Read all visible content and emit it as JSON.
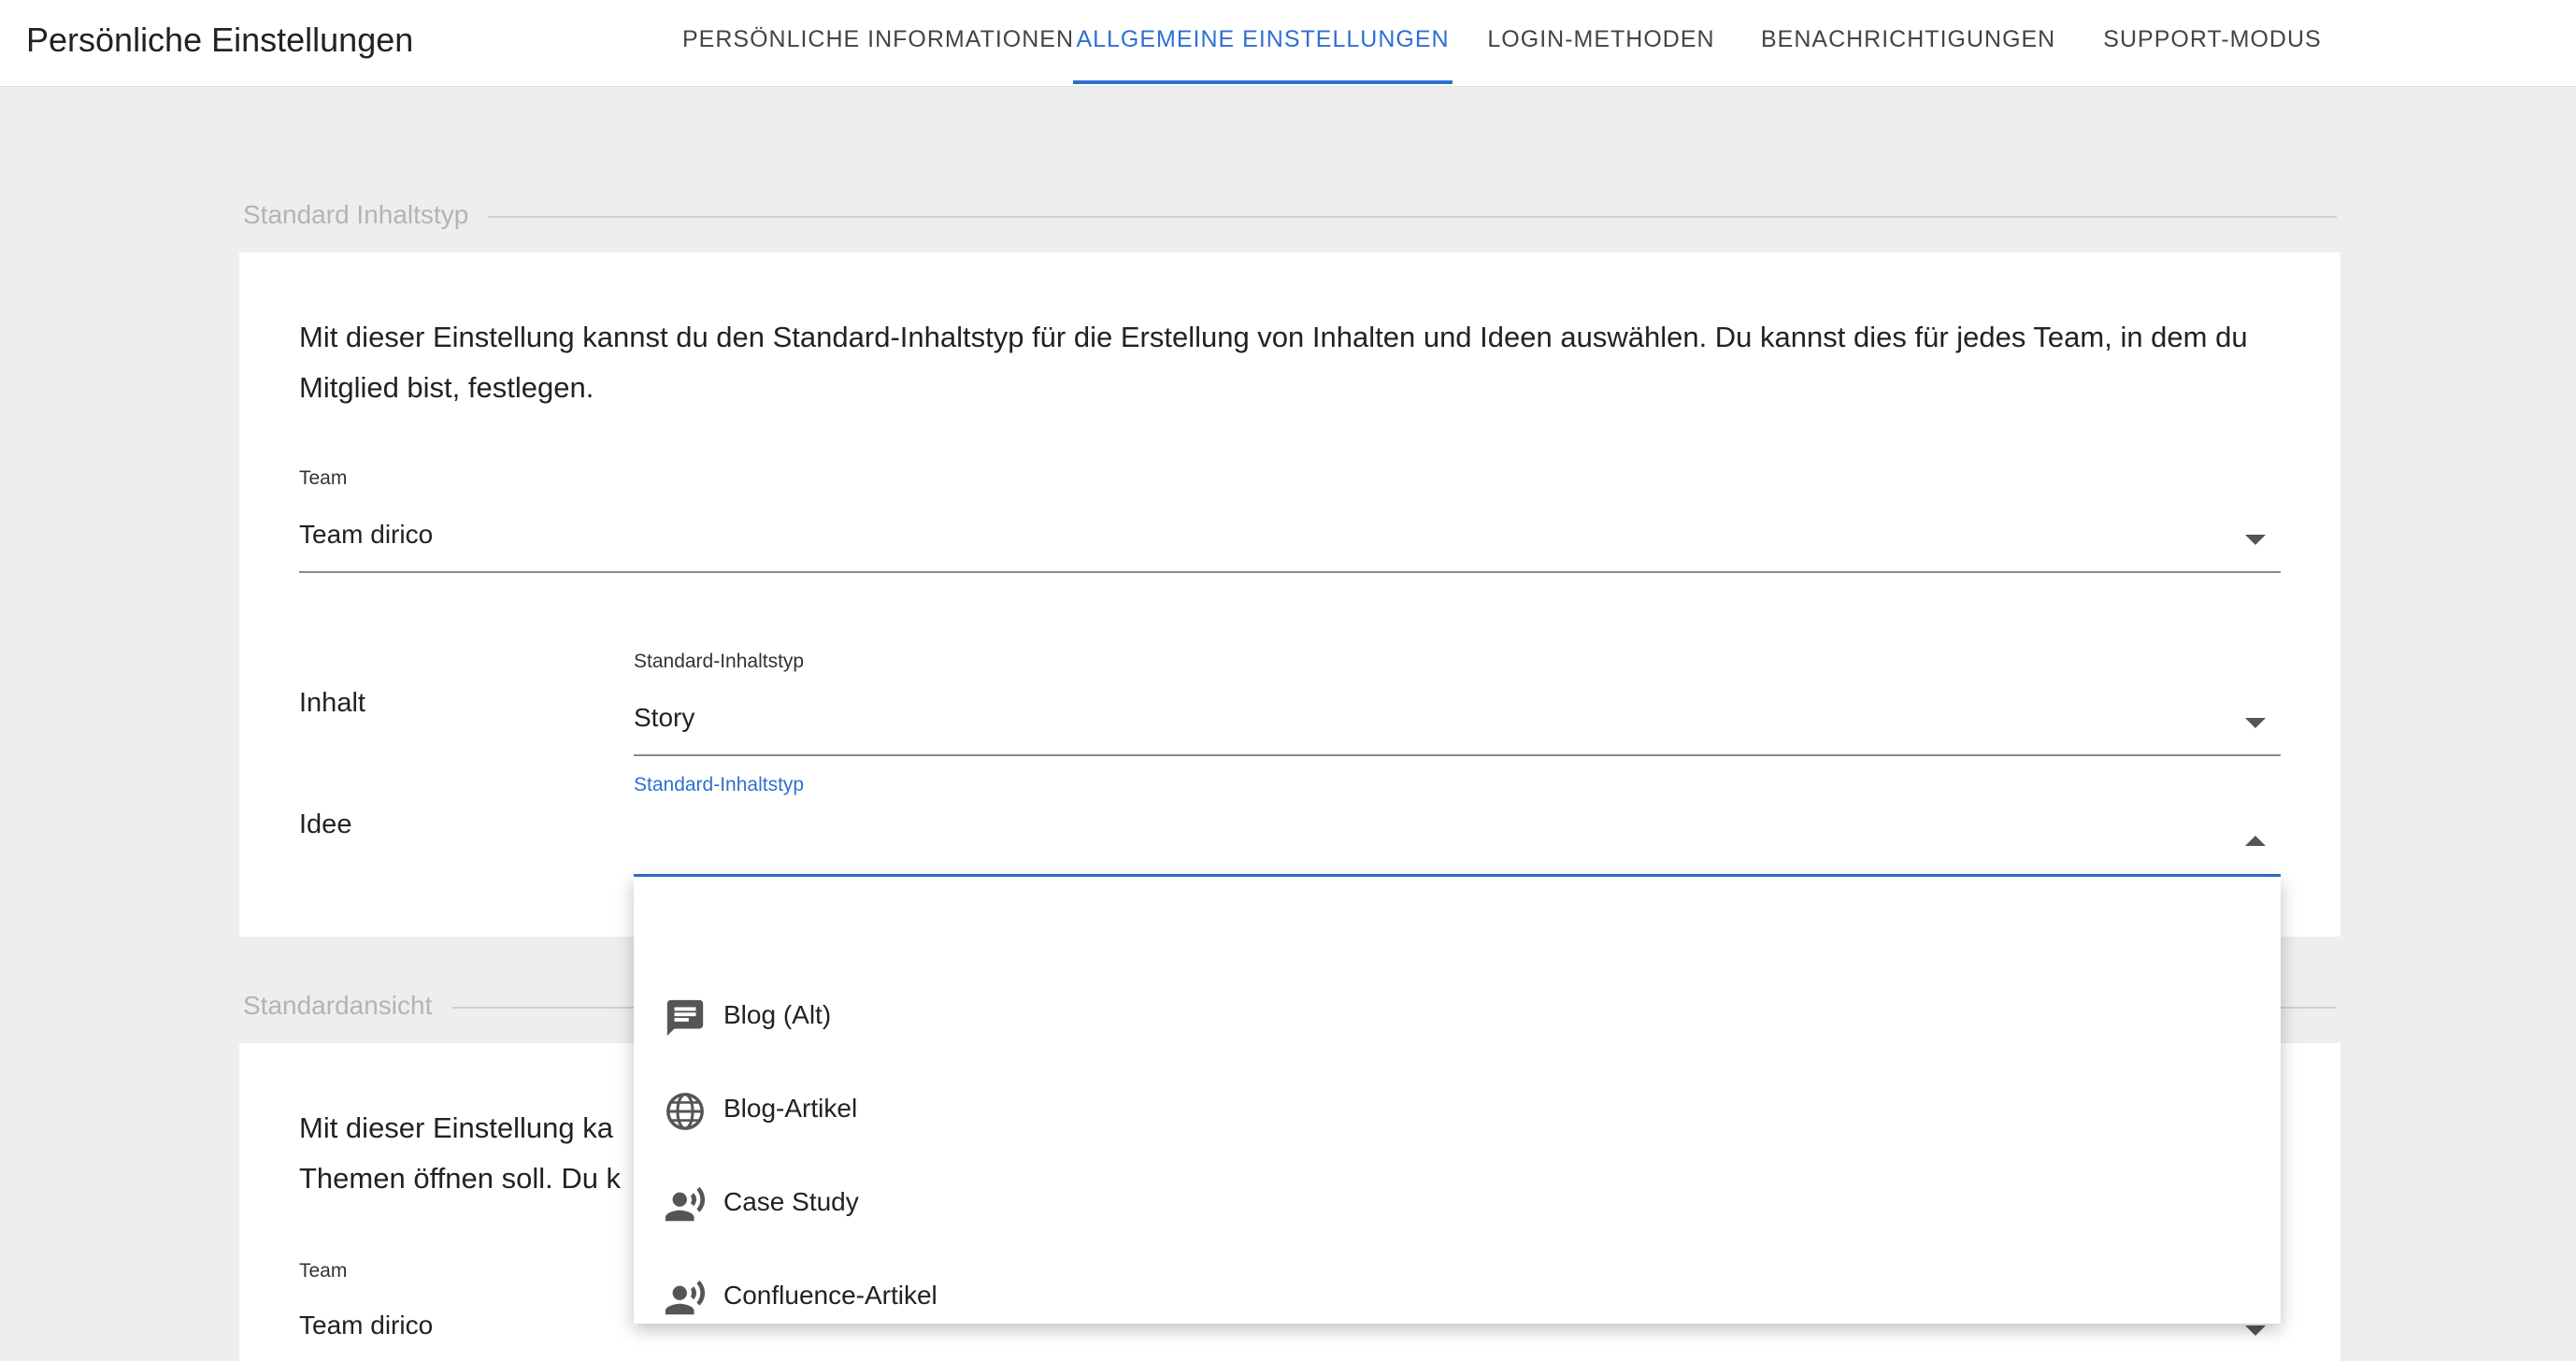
{
  "header": {
    "title": "Persönliche Einstellungen",
    "tabs": [
      {
        "label": "PERSÖNLICHE INFORMATIONEN",
        "active": false
      },
      {
        "label": "ALLGEMEINE EINSTELLUNGEN",
        "active": true
      },
      {
        "label": "LOGIN-METHODEN",
        "active": false
      },
      {
        "label": "BENACHRICHTIGUNGEN",
        "active": false
      },
      {
        "label": "SUPPORT-MODUS",
        "active": false
      }
    ]
  },
  "colors": {
    "accent": "#2f6fd1",
    "background": "#eeeeee",
    "card": "#ffffff"
  },
  "section1": {
    "label": "Standard Inhaltstyp",
    "description": "Mit dieser Einstellung kannst du den Standard-Inhaltstyp für die Erstellung von Inhalten und Ideen auswählen. Du kannst dies für jedes Team, in dem du Mitglied bist, festlegen.",
    "team_label": "Team",
    "team_value": "Team dirico",
    "inhalt_label": "Inhalt",
    "inhalt_field_label": "Standard-Inhaltstyp",
    "inhalt_value": "Story",
    "idee_label": "Idee",
    "idee_field_label": "Standard-Inhaltstyp",
    "idee_value": ""
  },
  "section2": {
    "label": "Standardansicht",
    "desc_line1": "Mit dieser Einstellung ka",
    "desc_line2": "Themen öffnen soll. Du k",
    "team_label": "Team",
    "team_value": "Team dirico"
  },
  "dropdown": {
    "items": [
      {
        "label": "Blog (Alt)",
        "icon": "message-icon"
      },
      {
        "label": "Blog-Artikel",
        "icon": "globe-icon"
      },
      {
        "label": "Case Study",
        "icon": "record-voice-icon"
      },
      {
        "label": "Confluence-Artikel",
        "icon": "record-voice-icon"
      }
    ]
  }
}
